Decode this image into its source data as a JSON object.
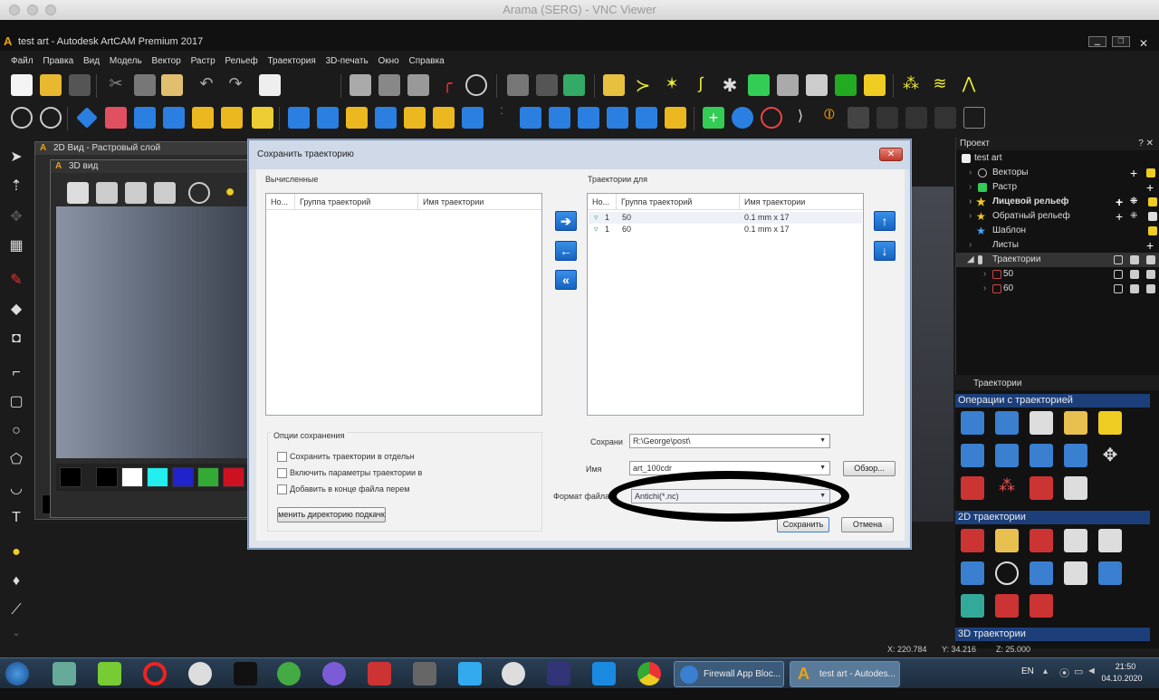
{
  "vnc": {
    "title": "Arama (SERG) - VNC Viewer"
  },
  "app": {
    "title": "test art - Autodesk ArtCAM Premium 2017",
    "menu": [
      "Файл",
      "Правка",
      "Вид",
      "Модель",
      "Вектор",
      "Растр",
      "Рельеф",
      "Траектория",
      "3D-печать",
      "Окно",
      "Справка"
    ]
  },
  "views": {
    "view2d_title": "2D Вид - Растровый слой",
    "view3d_title": "3D вид"
  },
  "project": {
    "header": "Проект",
    "header_icons": "? ✕",
    "items": [
      {
        "label": "test art"
      },
      {
        "label": "Векторы"
      },
      {
        "label": "Растр"
      },
      {
        "label": "Лицевой рельеф"
      },
      {
        "label": "Обратный рельеф"
      },
      {
        "label": "Шаблон"
      },
      {
        "label": "Листы"
      },
      {
        "label": "Траектории"
      },
      {
        "label": "50"
      },
      {
        "label": "60"
      }
    ]
  },
  "traj_panel": {
    "header": "Траектории",
    "sections": [
      "Операции с траекторией",
      "2D траектории",
      "3D траектории"
    ]
  },
  "dialog": {
    "title": "Сохранить траекторию",
    "close": "✕",
    "left_label": "Вычисленные",
    "right_label": "Траектории для",
    "cols": {
      "no": "Но...",
      "group": "Группа траекторий",
      "name": "Имя траектории"
    },
    "right_rows": [
      {
        "no": "1",
        "group": "50",
        "name": "0.1 mm x 17"
      },
      {
        "no": "1",
        "group": "60",
        "name": "0.1 mm x 17"
      }
    ],
    "options_label": "Опции сохранения",
    "options": [
      "Сохранить траектории в отдельн",
      "Включить параметры траектории в и",
      "Добавить в конце файла перем"
    ],
    "change_dir_button": "менить директорию подкачк",
    "save_in_label": "Сохрани",
    "save_in_value": "R:\\George\\post\\",
    "name_label": "Имя",
    "name_value": "art_100cdr",
    "browse_button": "Обзор...",
    "format_label": "Формат файла",
    "format_value": "Antichi(*.nc)",
    "save_button": "Сохранить",
    "cancel_button": "Отмена"
  },
  "status": {
    "x": "X: 220.784",
    "y": "Y: 34.216",
    "z": "Z: 25.000"
  },
  "taskbar": {
    "win1": "Firewall App Bloc...",
    "win2": "test art - Autodes...",
    "lang": "EN",
    "time": "21:50",
    "date": "04.10.2020"
  },
  "colors": {
    "accent": "#1c3f7a",
    "dialog_bg": "#dfe4ec",
    "arrow_blue": "#1565c0"
  }
}
